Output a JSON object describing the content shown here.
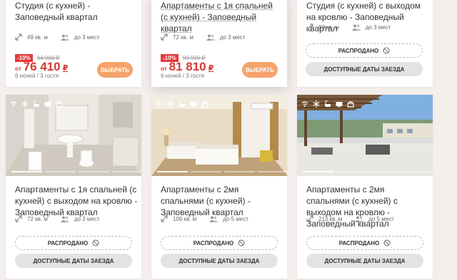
{
  "cards_top": [
    {
      "title": "Студия (с кухней) - Заповедный квартал",
      "area": "49 кв. м",
      "guests": "до 3 мест",
      "discount": "-10%",
      "old_price": "84 900 ₽",
      "price_prefix": "от",
      "price": "76 410",
      "currency": "₽",
      "nights": "6 ночей / 3 гостя",
      "button": "ВЫБРАТЬ"
    },
    {
      "title": "Апартаменты с 1я спальней (с кухней) - Заповедный квартал",
      "area": "72 кв. м",
      "guests": "до 3 мест",
      "discount": "-10%",
      "old_price": "90 900 ₽",
      "price_prefix": "от",
      "price": "81 810",
      "currency": "₽",
      "nights": "6 ночей / 3 гостя",
      "button": "ВЫБРАТЬ"
    },
    {
      "title": "Студия (с кухней) с выходом на кровлю - Заповедный квартал",
      "area": "93 кв. м",
      "guests": "до 3 мест",
      "sold": "РАСПРОДАНО",
      "dates": "ДОСТУПНЫЕ ДАТЫ ЗАЕЗДА"
    }
  ],
  "cards_bottom": [
    {
      "title": "Апартаменты с 1я спальней (с кухней) с выходом на кровлю - Заповедный квартал",
      "area": "72 кв. м",
      "guests": "до 3 мест",
      "sold": "РАСПРОДАНО",
      "dates": "ДОСТУПНЫЕ ДАТЫ ЗАЕЗДА"
    },
    {
      "title": "Апартаменты с 2мя спальнями (с кухней) - Заповедный квартал",
      "area": "106 кв. м",
      "guests": "до 5 мест",
      "sold": "РАСПРОДАНО",
      "dates": "ДОСТУПНЫЕ ДАТЫ ЗАЕЗДА"
    },
    {
      "title": "Апартаменты с 2мя спальнями (с кухней) с выходом на кровлю - Заповедный квартал",
      "area": "213 кв. м",
      "guests": "до 5 мест",
      "sold": "РАСПРОДАНО",
      "dates": "ДОСТУПНЫЕ ДАТЫ ЗАЕЗДА"
    }
  ],
  "colors": {
    "background": "#f4eeec",
    "price_red": "#d33a33",
    "discount_badge": "#e6373a",
    "choose_button": "#f5a36b",
    "dates_button": "#e4e2e2"
  },
  "icons": [
    "resize-arrows-icon",
    "guests-icon",
    "wifi-icon",
    "snowflake-icon",
    "bathroom-icon",
    "tv-icon",
    "kitchen-icon",
    "ban-icon"
  ]
}
